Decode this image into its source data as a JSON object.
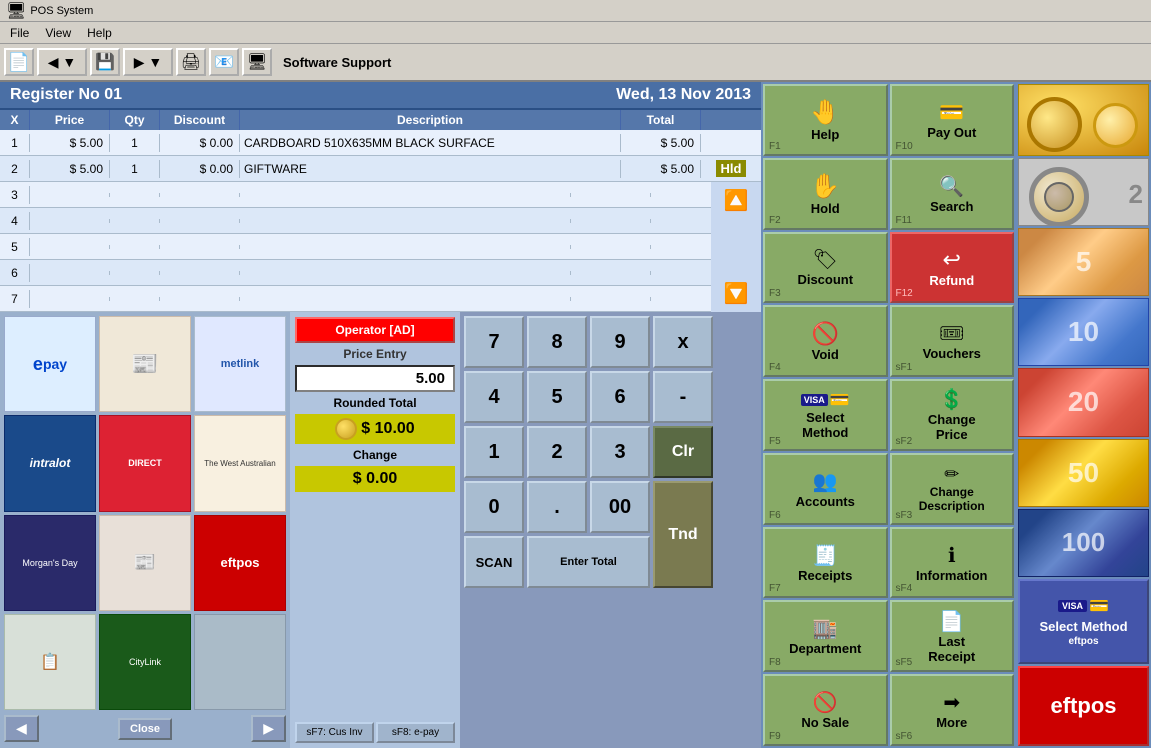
{
  "titlebar": {
    "title": "POS System"
  },
  "menubar": {
    "items": [
      "File",
      "View",
      "Help"
    ]
  },
  "toolbar": {
    "label": "Software Support"
  },
  "register": {
    "title": "Register No 01",
    "datetime": "Wed, 13 Nov 2013",
    "table": {
      "headers": [
        "X",
        "Price",
        "Qty",
        "Discount",
        "Description",
        "Total",
        ""
      ],
      "rows": [
        {
          "x": "1",
          "price": "$ 5.00",
          "qty": "1",
          "discount": "$ 0.00",
          "desc": "CARDBOARD 510X635MM BLACK SURFACE",
          "total": "$ 5.00",
          "hld": ""
        },
        {
          "x": "2",
          "price": "$ 5.00",
          "qty": "1",
          "discount": "$ 0.00",
          "desc": "GIFTWARE",
          "total": "$ 5.00",
          "hld": "Hld"
        },
        {
          "x": "3",
          "price": "",
          "qty": "",
          "discount": "",
          "desc": "",
          "total": "",
          "hld": ""
        },
        {
          "x": "4",
          "price": "",
          "qty": "",
          "discount": "",
          "desc": "",
          "total": "",
          "hld": ""
        },
        {
          "x": "5",
          "price": "",
          "qty": "",
          "discount": "",
          "desc": "",
          "total": "",
          "hld": ""
        },
        {
          "x": "6",
          "price": "",
          "qty": "",
          "discount": "",
          "desc": "",
          "total": "",
          "hld": ""
        },
        {
          "x": "7",
          "price": "",
          "qty": "",
          "discount": "",
          "desc": "",
          "total": "",
          "hld": ""
        }
      ]
    }
  },
  "operator": {
    "label": "Operator [AD]",
    "price_entry_label": "Price Entry",
    "price_entry_value": "5.00",
    "rounded_label": "Rounded Total",
    "rounded_value": "$ 10.00",
    "change_label": "Change",
    "change_value": "$ 0.00",
    "btn_cus_inv": "sF7: Cus Inv",
    "btn_epay": "sF8: e-pay"
  },
  "numpad": {
    "buttons": [
      "7",
      "8",
      "9",
      "x",
      "4",
      "5",
      "6",
      "-",
      "1",
      "2",
      "3",
      "Clr",
      "0",
      ".",
      "00",
      "Tnd"
    ],
    "scan_label": "SCAN",
    "enter_label": "Enter Total"
  },
  "logos": [
    {
      "name": "epay",
      "label": "epay",
      "color": "#e8f0ff"
    },
    {
      "name": "magazines",
      "label": "📰",
      "color": "#f0e8d8"
    },
    {
      "name": "metlink",
      "label": "metlink",
      "color": "#e0e8ff"
    },
    {
      "name": "intralot",
      "label": "intralot",
      "color": "#1a4a8a"
    },
    {
      "name": "direct",
      "label": "DIRECT",
      "color": "#cc2233"
    },
    {
      "name": "western-australian",
      "label": "The West Australian",
      "color": "#f8f0e0"
    },
    {
      "name": "morgans",
      "label": "Morgan's Day",
      "color": "#2a2a6a"
    },
    {
      "name": "magazines2",
      "label": "📰",
      "color": "#f0e8d8"
    },
    {
      "name": "eftpos",
      "label": "eftpos",
      "color": "#cc0000"
    },
    {
      "name": "misclogos",
      "label": "📋",
      "color": "#e0e8d0"
    },
    {
      "name": "citylink",
      "label": "CityLink",
      "color": "#1a5a1a"
    }
  ],
  "function_buttons": [
    {
      "label": "Help",
      "key": "F1",
      "icon": "help-icon"
    },
    {
      "label": "Pay Out",
      "key": "F10",
      "icon": "payout-icon"
    },
    {
      "label": "Hold",
      "key": "F2",
      "icon": "hold-icon"
    },
    {
      "label": "Search",
      "key": "F11",
      "icon": "search-icon"
    },
    {
      "label": "Discount",
      "key": "F3",
      "icon": "discount-icon"
    },
    {
      "label": "Refund",
      "key": "F12",
      "icon": "refund-icon",
      "color": "red"
    },
    {
      "label": "Void",
      "key": "F4",
      "icon": "void-icon"
    },
    {
      "label": "Vouchers",
      "key": "sF1",
      "icon": "vouchers-icon"
    },
    {
      "label": "Select Method",
      "key": "F5",
      "icon": "select-method-icon"
    },
    {
      "label": "Change Price",
      "key": "sF2",
      "icon": "change-price-icon"
    },
    {
      "label": "Accounts",
      "key": "F6",
      "icon": "accounts-icon"
    },
    {
      "label": "Change Description",
      "key": "sF3",
      "icon": "change-desc-icon"
    },
    {
      "label": "Receipts",
      "key": "F7",
      "icon": "receipts-icon"
    },
    {
      "label": "Information",
      "key": "sF4",
      "icon": "information-icon"
    },
    {
      "label": "Department",
      "key": "F8",
      "icon": "department-icon"
    },
    {
      "label": "Last Receipt",
      "key": "sF5",
      "icon": "last-receipt-icon"
    },
    {
      "label": "No Sale",
      "key": "F9",
      "icon": "no-sale-icon"
    },
    {
      "label": "More",
      "key": "sF6",
      "icon": "more-icon"
    }
  ],
  "select_method_large": {
    "label": "Select Method",
    "sub": "eftpos"
  },
  "eftpos_large": {
    "label": "eftpos"
  },
  "colors": {
    "green_btn": "#8aaa6a",
    "red_btn": "#cc3333",
    "blue_btn": "#3355aa",
    "header_bg": "#4a6fa5",
    "table_bg": "#dce8f8"
  }
}
